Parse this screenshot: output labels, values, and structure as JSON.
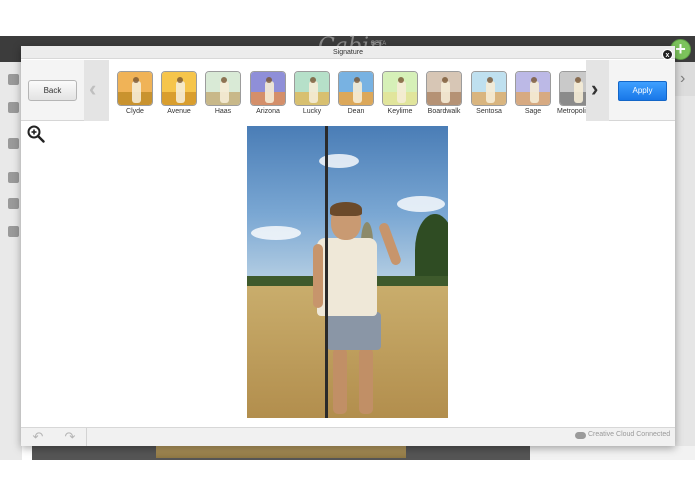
{
  "app": {
    "logo_text": "Cabin",
    "beta_label": "BETA"
  },
  "dialog": {
    "title": "Signature",
    "close_label": "x",
    "back_label": "Back",
    "apply_label": "Apply",
    "prev_icon": "chevron-left-icon",
    "next_icon": "chevron-right-icon"
  },
  "filters": [
    {
      "label": "Clyde",
      "sky": "#f0b357",
      "grass": "#c9932f"
    },
    {
      "label": "Avenue",
      "sky": "#f6c54b",
      "grass": "#d99e2e"
    },
    {
      "label": "Haas",
      "sky": "#d9ead6",
      "grass": "#c8b889"
    },
    {
      "label": "Arizona",
      "sky": "#8f8fd8",
      "grass": "#d48f6a"
    },
    {
      "label": "Lucky",
      "sky": "#b6e0c9",
      "grass": "#d8c070"
    },
    {
      "label": "Dean",
      "sky": "#78b2e2",
      "grass": "#dca85a"
    },
    {
      "label": "Keylime",
      "sky": "#d6f0b8",
      "grass": "#e1e59c"
    },
    {
      "label": "Boardwalk",
      "sky": "#d7c6b5",
      "grass": "#b59275"
    },
    {
      "label": "Sentosa",
      "sky": "#bfe0ef",
      "grass": "#d9b57f"
    },
    {
      "label": "Sage",
      "sky": "#bcb9e6",
      "grass": "#d7aa82"
    },
    {
      "label": "Metropolis",
      "sky": "#c9c9c9",
      "grass": "#8b8b8b"
    }
  ],
  "footer": {
    "undo_icon": "undo-icon",
    "redo_icon": "redo-icon",
    "status_text": "Creative Cloud Connected"
  },
  "colors": {
    "apply_accent": "#1e7ff0",
    "add_button": "#7cc35c"
  }
}
